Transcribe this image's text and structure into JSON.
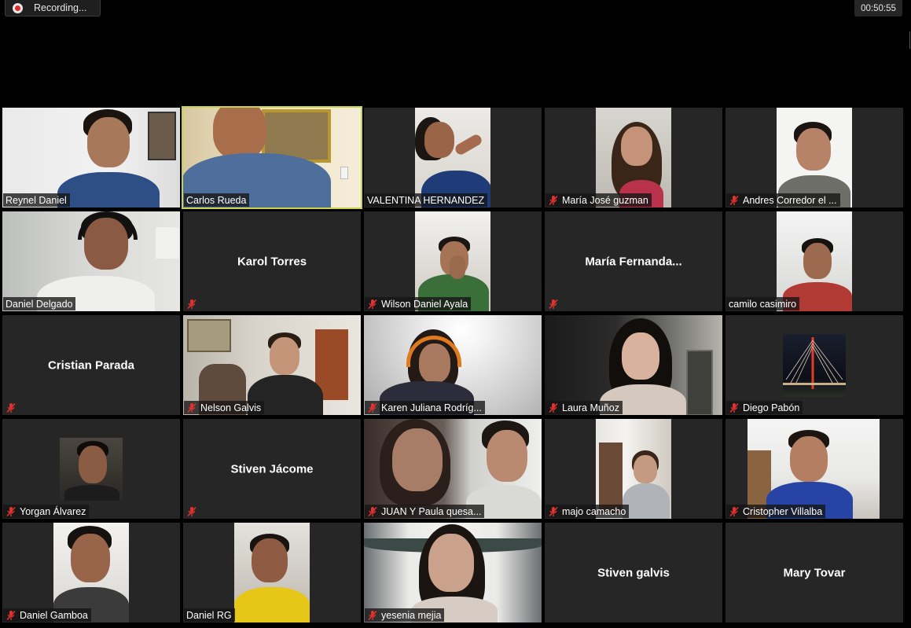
{
  "recording": {
    "label": "Recording..."
  },
  "timer": {
    "elapsed": "00:50:55"
  },
  "participants": [
    {
      "name": "Reynel Daniel",
      "muted": false,
      "video": true
    },
    {
      "name": "Carlos Rueda",
      "muted": false,
      "video": true,
      "speaking": true
    },
    {
      "name": "VALENTINA HERNANDEZ",
      "muted": false,
      "video": true
    },
    {
      "name": "María José guzman",
      "muted": true,
      "video": true
    },
    {
      "name": "Andres Corredor el ...",
      "muted": true,
      "video": true
    },
    {
      "name": "Daniel Delgado",
      "muted": false,
      "video": true
    },
    {
      "name": "Karol Torres",
      "muted": true,
      "video": false
    },
    {
      "name": "Wilson Daniel Ayala",
      "muted": true,
      "video": true
    },
    {
      "name": "María  Fernanda...",
      "muted": true,
      "video": false
    },
    {
      "name": "camilo casimiro",
      "muted": false,
      "video": true
    },
    {
      "name": "Cristian Parada",
      "muted": true,
      "video": false
    },
    {
      "name": "Nelson Galvis",
      "muted": true,
      "video": true
    },
    {
      "name": "Karen Juliana Rodríg...",
      "muted": true,
      "video": true
    },
    {
      "name": "Laura Muñoz",
      "muted": true,
      "video": true
    },
    {
      "name": "Diego Pabón",
      "muted": true,
      "video": false,
      "avatar": "bridge-photo"
    },
    {
      "name": "Yorgan Álvarez",
      "muted": true,
      "video": false,
      "avatar": "profile-photo"
    },
    {
      "name": "Stiven Jácome",
      "muted": true,
      "video": false
    },
    {
      "name": "JUAN Y Paula quesa...",
      "muted": true,
      "video": true
    },
    {
      "name": "majo camacho",
      "muted": true,
      "video": true
    },
    {
      "name": "Cristopher Villalba",
      "muted": true,
      "video": true
    },
    {
      "name": "Daniel Gamboa",
      "muted": true,
      "video": true
    },
    {
      "name": "Daniel RG",
      "muted": false,
      "video": true
    },
    {
      "name": "yesenia mejia",
      "muted": true,
      "video": true
    },
    {
      "name": "Stiven galvis",
      "muted": false,
      "video": false
    },
    {
      "name": "Mary Tovar",
      "muted": false,
      "video": false
    }
  ],
  "colors": {
    "tile_bg": "#262626",
    "speaker_border": "#c9d24a",
    "mute_red": "#e0322f"
  }
}
